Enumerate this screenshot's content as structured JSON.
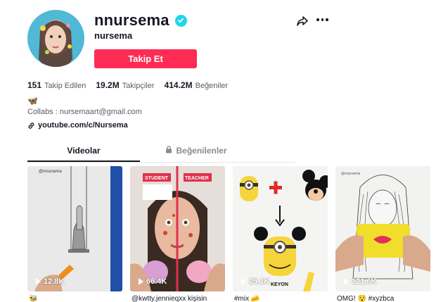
{
  "profile": {
    "username": "nnursema",
    "nickname": "nursema",
    "follow_label": "Takip Et"
  },
  "stats": [
    {
      "num": "151",
      "label": "Takip Edilen"
    },
    {
      "num": "19.2M",
      "label": "Takipçiler"
    },
    {
      "num": "414.2M",
      "label": "Beğeniler"
    }
  ],
  "bio": {
    "emoji": "🦋",
    "text": "Collabs : nursemaart@gmail.com",
    "link": "youtube.com/c/Nursema"
  },
  "tabs": {
    "videos": "Videolar",
    "liked": "Beğenilenler"
  },
  "videos": [
    {
      "views": "12.8K",
      "caption": "🐝"
    },
    {
      "views": "66.4K",
      "caption": "@kwtty.jennieqxx kişisin"
    },
    {
      "views": "25.1K",
      "caption": "#mix 🧀"
    },
    {
      "views": "121.6K",
      "caption": "OMG! 😯 #xyzbca"
    }
  ],
  "thumb_text": {
    "handle1": "@nnursema",
    "student": "STUDENT",
    "teacher": "TEACHER",
    "keyon": "KEYON"
  },
  "colors": {
    "accent": "#fe2c55",
    "verified": "#20d5ec",
    "text": "#161823",
    "muted": "#5b5c65"
  },
  "icons": [
    "verified-badge-icon",
    "share-icon",
    "more-icon",
    "link-icon",
    "lock-icon",
    "play-icon"
  ]
}
